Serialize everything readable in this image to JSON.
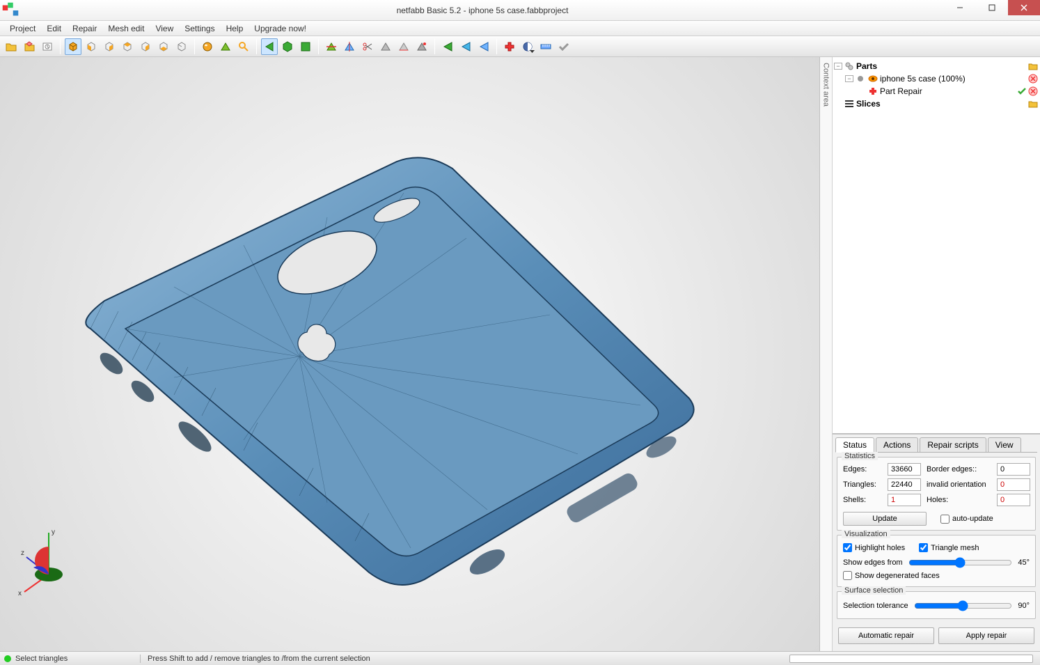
{
  "title": "netfabb Basic 5.2 - iphone 5s case.fabbproject",
  "menu": [
    "Project",
    "Edit",
    "Repair",
    "Mesh edit",
    "View",
    "Settings",
    "Help",
    "Upgrade now!"
  ],
  "toolbar_groups": {
    "g1": [
      "open-project-icon",
      "add-part-icon",
      "platform-overview-icon"
    ],
    "g2": [
      "cube-persp-icon",
      "cube-front-icon",
      "cube-back-icon",
      "cube-left-icon",
      "cube-right-icon",
      "cube-top-icon",
      "cube-bottom-icon"
    ],
    "g3": [
      "sphere-icon",
      "triangle-select-icon",
      "zoom-icon"
    ],
    "g4": [
      "green-arrow-left-icon",
      "green-hex-icon",
      "green-square-icon"
    ],
    "g5": [
      "cut-tri-icon",
      "cut-mirror-icon",
      "scissors-icon",
      "gray-tri-1-icon",
      "gray-tri-2-icon",
      "gray-tri-3-icon"
    ],
    "g6": [
      "flip-x-icon",
      "flip-y-icon",
      "flip-z-icon"
    ],
    "g7": [
      "repair-red-cross-icon",
      "analysis-swirl-icon",
      "ruler-icon",
      "check-gray-icon"
    ]
  },
  "context_tab": "Context area",
  "tree": {
    "parts_label": "Parts",
    "item_label": "iphone 5s case (100%)",
    "repair_label": "Part Repair",
    "slices_label": "Slices"
  },
  "tabs": [
    "Status",
    "Actions",
    "Repair scripts",
    "View"
  ],
  "stats": {
    "group_title": "Statistics",
    "edges_label": "Edges:",
    "edges_val": "33660",
    "border_label": "Border edges::",
    "border_val": "0",
    "tri_label": "Triangles:",
    "tri_val": "22440",
    "inv_label": "invalid orientation",
    "inv_val": "0",
    "shells_label": "Shells:",
    "shells_val": "1",
    "holes_label": "Holes:",
    "holes_val": "0",
    "update_btn": "Update",
    "auto_update": "auto-update"
  },
  "viz": {
    "group_title": "Visualization",
    "highlight_holes": "Highlight holes",
    "triangle_mesh": "Triangle mesh",
    "show_edges_from": "Show edges from",
    "edges_deg": "45°",
    "show_degen": "Show degenerated faces"
  },
  "surf": {
    "group_title": "Surface selection",
    "tolerance": "Selection tolerance",
    "tol_deg": "90°"
  },
  "btns": {
    "auto_repair": "Automatic repair",
    "apply_repair": "Apply repair"
  },
  "status": {
    "mode": "Select triangles",
    "hint": "Press Shift to add / remove triangles to /from the current selection"
  },
  "axis": {
    "x": "x",
    "y": "y",
    "z": "z"
  }
}
